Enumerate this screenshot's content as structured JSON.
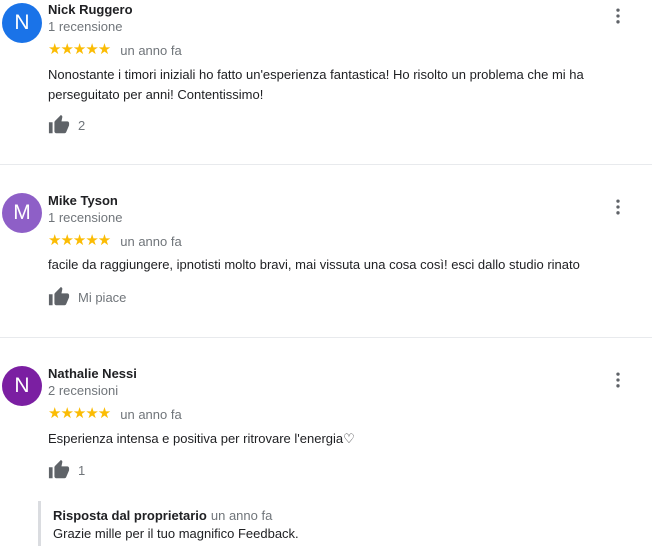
{
  "reviews": [
    {
      "avatar_letter": "N",
      "avatar_color": "#1a73e8",
      "name": "Nick Ruggero",
      "count": "1 recensione",
      "stars": "★★★★★",
      "date": "un anno fa",
      "text": "Nonostante i timori iniziali ho fatto un'esperienza fantastica! Ho risolto un problema che mi ha perseguitato per anni! Contentissimo!",
      "like": "2"
    },
    {
      "avatar_letter": "M",
      "avatar_color": "#8e5fc7",
      "name": "Mike Tyson",
      "count": "1 recensione",
      "stars": "★★★★★",
      "date": "un anno fa",
      "text": "facile da raggiungere, ipnotisti molto bravi, mai vissuta una cosa così! esci dallo studio rinato",
      "like": "Mi piace"
    },
    {
      "avatar_letter": "N",
      "avatar_color": "#7b1fa2",
      "name": "Nathalie Nessi",
      "count": "2 recensioni",
      "stars": "★★★★★",
      "date": "un anno fa",
      "text": "Esperienza intensa e positiva per ritrovare l'energia♡",
      "like": "1"
    }
  ],
  "reply": {
    "title": "Risposta dal proprietario",
    "date": "un anno fa",
    "text": "Grazie mille per il tuo magnifico Feedback."
  },
  "icons": {
    "like": "thumb-up-icon",
    "more": "more-vert-icon"
  },
  "colors": {
    "star": "#fbbc04",
    "secondary_text": "#70757a",
    "divider": "#e8eaed",
    "icon": "#5f6368"
  }
}
